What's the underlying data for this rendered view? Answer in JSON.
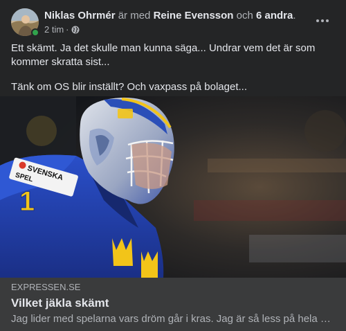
{
  "post": {
    "author": "Niklas Ohrmér",
    "with_text": "är med",
    "tagged_person": "Reine Evensson",
    "and_text": "och",
    "others": "6 andra",
    "period": ".",
    "timestamp": "2 tim",
    "separator": "·",
    "privacy_icon": "globe-icon",
    "more_icon": "more-horizontal-icon",
    "body_paragraphs": [
      "Ett skämt. Ja det skulle man kunna säga... Undrar vem det är som kommer skratta sist...",
      "Tänk om OS blir inställt? Och vaxpass på bolaget..."
    ]
  },
  "link_preview": {
    "jersey_sponsor": "SVENSKA SPEL",
    "jersey_number": "1",
    "domain": "EXPRESSEN.SE",
    "title": "Vilket jäkla skämt",
    "description": "Jag lider med spelarna vars dröm går i kras. Jag är så less på hela den här..."
  },
  "colors": {
    "background": "#242526",
    "card": "#3a3b3c",
    "online": "#31a24c",
    "jersey_blue": "#1f3fb0",
    "crown_gold": "#f2c419"
  }
}
